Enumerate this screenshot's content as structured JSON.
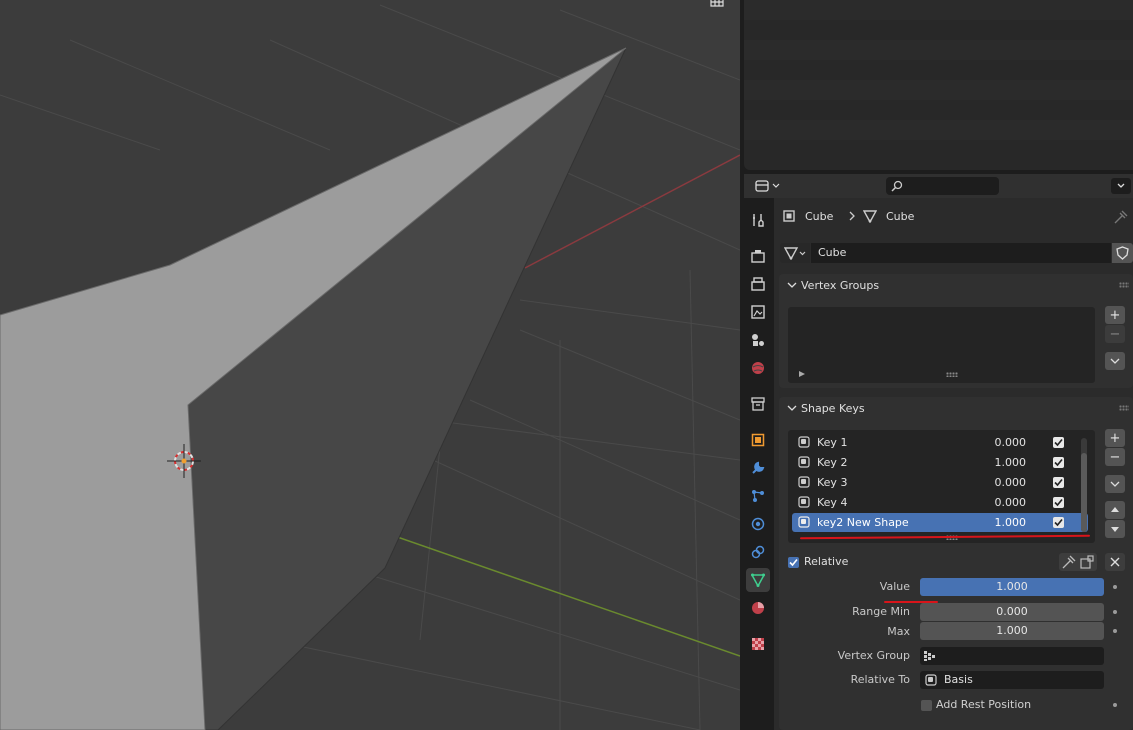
{
  "outliner": {},
  "header": {
    "search_placeholder": ""
  },
  "breadcrumb": {
    "object": "Cube",
    "data": "Cube"
  },
  "mesh_datablock": {
    "name": "Cube"
  },
  "vertex_groups": {
    "title": "Vertex Groups"
  },
  "shape_keys": {
    "title": "Shape Keys",
    "items": [
      {
        "name": "Key 1",
        "value": "0.000",
        "checked": true,
        "selected": false
      },
      {
        "name": "Key 2",
        "value": "1.000",
        "checked": true,
        "selected": false
      },
      {
        "name": "Key 3",
        "value": "0.000",
        "checked": true,
        "selected": false
      },
      {
        "name": "Key 4",
        "value": "0.000",
        "checked": true,
        "selected": false
      },
      {
        "name": "key2 New Shape",
        "value": "1.000",
        "checked": true,
        "selected": true
      }
    ],
    "relative_label": "Relative",
    "value_label": "Value",
    "value": "1.000",
    "range_min_label": "Range Min",
    "range_min": "0.000",
    "max_label": "Max",
    "max": "1.000",
    "vertex_group_label": "Vertex Group",
    "vertex_group_value": "",
    "relative_to_label": "Relative To",
    "relative_to_value": "Basis",
    "add_rest_label": "Add Rest Position"
  },
  "colors": {
    "accent": "#4772b3",
    "annotation_red": "#d8141a",
    "viewport_bg": "#3c3c3c",
    "panel_bg": "#303030"
  },
  "icons": [
    "tool-icon",
    "render-icon",
    "output-icon",
    "view-layer-icon",
    "scene-icon",
    "world-icon",
    "collection-icon",
    "object-icon",
    "modifier-icon",
    "particles-icon",
    "physics-icon",
    "constraints-icon",
    "mesh-data-icon",
    "material-icon",
    "texture-icon"
  ]
}
